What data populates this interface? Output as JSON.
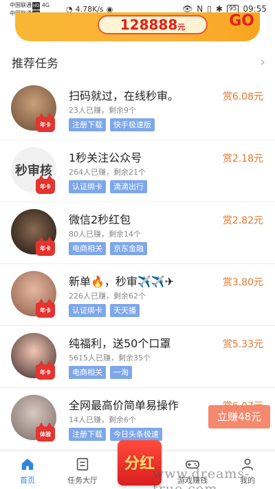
{
  "status_bar": {
    "carrier1": "中国联通",
    "carrier2": "中国联通",
    "hd": "HD",
    "net": "4G",
    "speed": "4.78K/s",
    "battery": "95",
    "time": "09:55"
  },
  "banner": {
    "amount": "128888",
    "unit": "元",
    "go": "GO"
  },
  "section": {
    "title": "推荐任务"
  },
  "tasks": [
    {
      "title": "扫码就过，在线秒审。",
      "stats": "23人已赚，剩余9个",
      "tags": [
        "注册下载",
        "快手极速版"
      ],
      "reward": "赏6.08元",
      "badge": "年卡",
      "avatar_text": ""
    },
    {
      "title": "1秒关注公众号",
      "stats": "264人已赚，剩余21个",
      "tags": [
        "认证绑卡",
        "滴滴出行"
      ],
      "reward": "赏2.18元",
      "badge": "年卡",
      "avatar_text": "秒审核"
    },
    {
      "title": "微信2秒红包",
      "stats": "80人已赚，剩余14个",
      "tags": [
        "电商相关",
        "京东金融"
      ],
      "reward": "赏2.82元",
      "badge": "年卡",
      "avatar_text": ""
    },
    {
      "title": "新单🔥，秒审✈️✈️✈",
      "stats": "226人已赚，剩余62个",
      "tags": [
        "认证绑卡",
        "天天播"
      ],
      "reward": "赏3.80元",
      "badge": "年卡",
      "avatar_text": ""
    },
    {
      "title": "纯福利，送50个口罩",
      "stats": "5615人已赚，剩余35个",
      "tags": [
        "电商相关",
        "一淘"
      ],
      "reward": "赏5.33元",
      "badge": "年卡",
      "avatar_text": ""
    },
    {
      "title": "全网最高价简单易操作",
      "stats": "14人已赚，剩余6个",
      "tags": [
        "注册下载",
        "今日头条极速"
      ],
      "reward": "赏6.07元",
      "badge": "体验",
      "avatar_text": ""
    }
  ],
  "float_button": "立赚48元",
  "fenhong": "分红",
  "nav": {
    "home": "首页",
    "hall": "任务大厅",
    "game": "游戏赚钱",
    "mine": "我的"
  },
  "watermark": "www.dreams-true.com",
  "colors": {
    "accent": "#2f88e0",
    "reward": "#e5772b",
    "tag": "#7ea7e9",
    "float": "#f58367"
  }
}
